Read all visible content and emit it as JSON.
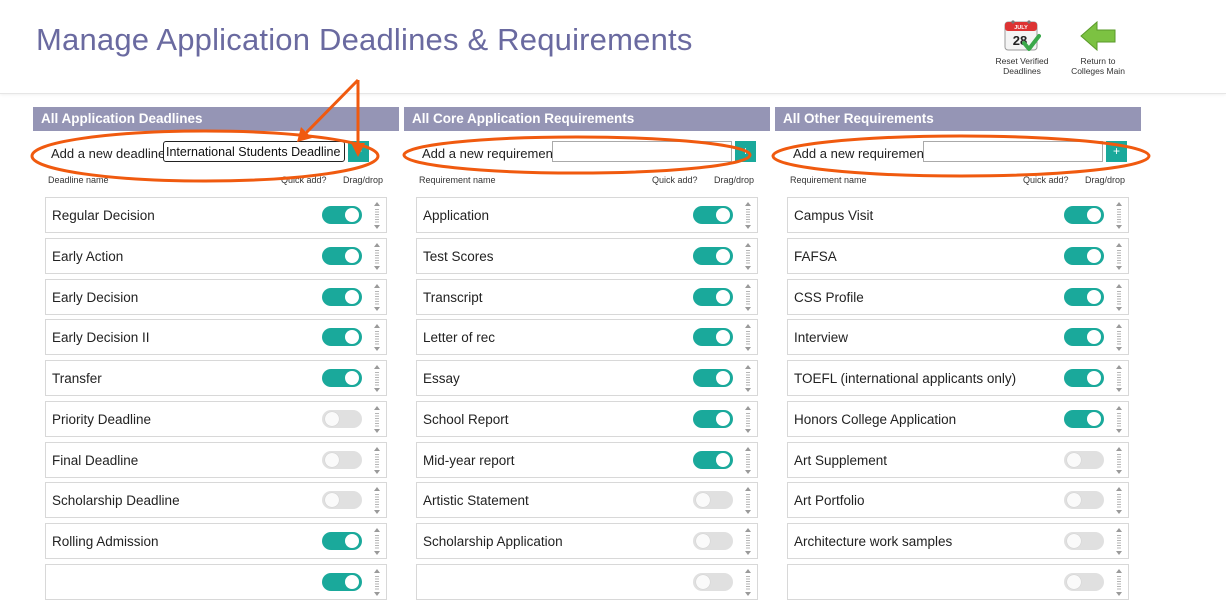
{
  "page": {
    "title": "Manage Application Deadlines & Requirements"
  },
  "header_buttons": {
    "reset": {
      "label_line1": "Reset Verified",
      "label_line2": "Deadlines",
      "icon": "calendar-check-icon",
      "calendar_month": "JULY",
      "calendar_day": "28"
    },
    "return": {
      "label_line1": "Return to",
      "label_line2": "Colleges Main",
      "icon": "arrow-left-icon"
    }
  },
  "colors": {
    "accent": "#1aa99b",
    "column_header": "#9595b5",
    "title": "#6a6aa0",
    "annotation": "#f05a0f"
  },
  "columns": [
    {
      "header": "All Application Deadlines",
      "add_label": "Add a new deadline",
      "add_value": "International Students Deadline",
      "add_button": "+",
      "col_name": "Deadline name",
      "col_quick": "Quick add?",
      "col_drag": "Drag/drop",
      "items": [
        {
          "label": "Regular Decision",
          "on": true
        },
        {
          "label": "Early Action",
          "on": true
        },
        {
          "label": "Early Decision",
          "on": true
        },
        {
          "label": "Early Decision II",
          "on": true
        },
        {
          "label": "Transfer",
          "on": true
        },
        {
          "label": "Priority Deadline",
          "on": false
        },
        {
          "label": "Final Deadline",
          "on": false
        },
        {
          "label": "Scholarship Deadline",
          "on": false
        },
        {
          "label": "Rolling Admission",
          "on": true
        },
        {
          "label": "",
          "on": true
        }
      ]
    },
    {
      "header": "All Core Application Requirements",
      "add_label": "Add a new requirement",
      "add_value": "",
      "add_button": "+",
      "col_name": "Requirement name",
      "col_quick": "Quick add?",
      "col_drag": "Drag/drop",
      "items": [
        {
          "label": "Application",
          "on": true
        },
        {
          "label": "Test Scores",
          "on": true
        },
        {
          "label": "Transcript",
          "on": true
        },
        {
          "label": "Letter of rec",
          "on": true
        },
        {
          "label": "Essay",
          "on": true
        },
        {
          "label": "School Report",
          "on": true
        },
        {
          "label": "Mid-year report",
          "on": true
        },
        {
          "label": "Artistic Statement",
          "on": false
        },
        {
          "label": "Scholarship Application",
          "on": false
        },
        {
          "label": "",
          "on": false
        }
      ]
    },
    {
      "header": "All Other Requirements",
      "add_label": "Add a new requirement",
      "add_value": "",
      "add_button": "+",
      "col_name": "Requirement name",
      "col_quick": "Quick add?",
      "col_drag": "Drag/drop",
      "items": [
        {
          "label": "Campus Visit",
          "on": true
        },
        {
          "label": "FAFSA",
          "on": true
        },
        {
          "label": "CSS Profile",
          "on": true
        },
        {
          "label": "Interview",
          "on": true
        },
        {
          "label": "TOEFL (international applicants only)",
          "on": true
        },
        {
          "label": "Honors College Application",
          "on": true
        },
        {
          "label": "Art Supplement",
          "on": false
        },
        {
          "label": "Art Portfolio",
          "on": false
        },
        {
          "label": "Architecture work samples",
          "on": false
        },
        {
          "label": "",
          "on": false
        }
      ]
    }
  ]
}
